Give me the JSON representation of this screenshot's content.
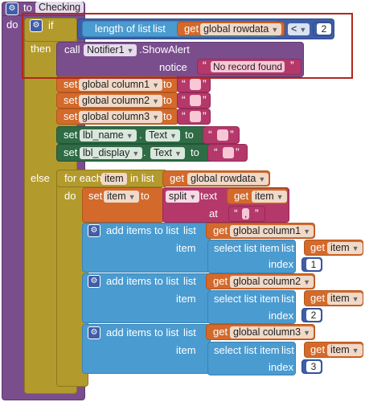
{
  "procedure": {
    "to_label": "to",
    "name": "Checking",
    "do_label": "do"
  },
  "if_block": {
    "if_label": "if",
    "then_label": "then",
    "else_label": "else",
    "condition": {
      "length_label": "length of list",
      "list_label": "list",
      "get_label": "get",
      "variable": "global rowdata",
      "operator": "<",
      "value": "2"
    },
    "then_items": [
      {
        "call_label": "call",
        "component": "Notifier1",
        "method": ".ShowAlert",
        "notice_label": "notice",
        "notice_text": "No record found"
      }
    ],
    "sets": [
      {
        "set_label": "set",
        "variable": "global column1",
        "to_label": "to"
      },
      {
        "set_label": "set",
        "variable": "global column2",
        "to_label": "to"
      },
      {
        "set_label": "set",
        "variable": "global column3",
        "to_label": "to"
      }
    ],
    "component_sets": [
      {
        "set_label": "set",
        "component": "lbl_name",
        "dot": ".",
        "property": "Text",
        "to_label": "to"
      },
      {
        "set_label": "set",
        "component": "lbl_display",
        "dot": ".",
        "property": "Text",
        "to_label": "to"
      }
    ]
  },
  "foreach": {
    "for_each_label": "for each",
    "item_var": "item",
    "in_list_label": "in list",
    "get_label": "get",
    "list_var": "global rowdata",
    "do_label": "do",
    "set_item": {
      "set_label": "set",
      "variable": "item",
      "to_label": "to",
      "split_label": "split",
      "text_label": "text",
      "get_label": "get",
      "get_var": "item",
      "at_label": "at",
      "at_value": ","
    },
    "adds": [
      {
        "add_label": "add items to list",
        "list_label": "list",
        "get_label": "get",
        "target": "global column1",
        "item_label": "item",
        "select_label": "select list item",
        "list2_label": "list",
        "get2_label": "get",
        "source": "item",
        "index_label": "index",
        "index": "1"
      },
      {
        "add_label": "add items to list",
        "list_label": "list",
        "get_label": "get",
        "target": "global column2",
        "item_label": "item",
        "select_label": "select list item",
        "list2_label": "list",
        "get2_label": "get",
        "source": "item",
        "index_label": "index",
        "index": "2"
      },
      {
        "add_label": "add items to list",
        "list_label": "list",
        "get_label": "get",
        "target": "global column3",
        "item_label": "item",
        "select_label": "select list item",
        "list2_label": "list",
        "get2_label": "get",
        "source": "item",
        "index_label": "index",
        "index": "3"
      }
    ]
  },
  "icons": {
    "gear": "gear-icon",
    "dropdown": "dropdown-arrow-icon"
  },
  "colors": {
    "procedure": "#7a4e8d",
    "control": "#b39a2c",
    "math": "#3f5ea8",
    "lists": "#4a9bd0",
    "variables": "#d36a2b",
    "text": "#b5386b",
    "components": "#2f6b45",
    "highlight": "#b3261e"
  }
}
